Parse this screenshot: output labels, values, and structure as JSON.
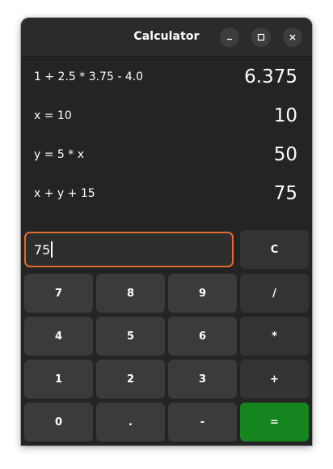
{
  "window": {
    "title": "Calculator",
    "controls": [
      "minimize-icon",
      "maximize-icon",
      "close-icon"
    ]
  },
  "history": [
    {
      "expression": "1 + 2.5 * 3.75 - 4.0",
      "result": "6.375"
    },
    {
      "expression": "x = 10",
      "result": "10"
    },
    {
      "expression": "y = 5 * x",
      "result": "50"
    },
    {
      "expression": "x + y + 15",
      "result": "75"
    }
  ],
  "entry": {
    "value": "75"
  },
  "keys": {
    "clear": "C",
    "seven": "7",
    "eight": "8",
    "nine": "9",
    "divide": "/",
    "four": "4",
    "five": "5",
    "six": "6",
    "multiply": "*",
    "one": "1",
    "two": "2",
    "three": "3",
    "plus": "+",
    "zero": "0",
    "point": ".",
    "minus": "-",
    "equals": "="
  },
  "colors": {
    "window_bg": "#242424",
    "key_bg": "#3b3b3b",
    "operator_bg": "#333333",
    "equals_bg": "#15851f",
    "focus_border": "#e2692f"
  }
}
